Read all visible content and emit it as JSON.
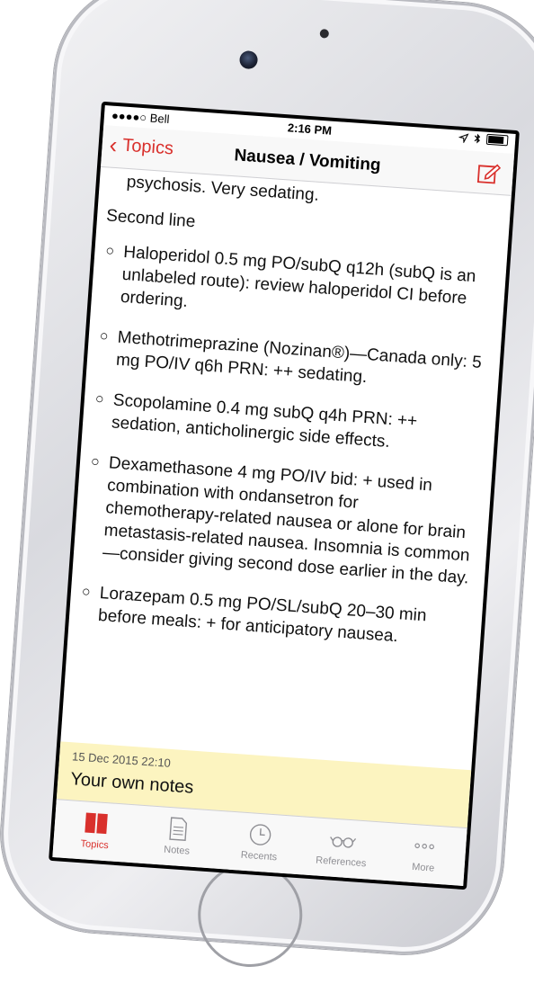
{
  "status_bar": {
    "carrier": "●●●●○ Bell",
    "time": "2:16 PM"
  },
  "nav": {
    "back_label": "Topics",
    "title": "Nausea / Vomiting"
  },
  "content": {
    "top_text": "psychosis. Very sedating.",
    "section_heading": "Second line",
    "bullets": [
      "Haloperidol 0.5 mg PO/subQ q12h (subQ is an unlabeled route): review haloperidol CI before ordering.",
      "Methotrimeprazine (Nozinan®)—Canada only: 5 mg PO/IV q6h PRN: ++ sedating.",
      "Scopolamine 0.4 mg subQ q4h PRN: ++ sedation, anticholinergic side effects.",
      "Dexamethasone 4 mg PO/IV bid: + used in combination with ondansetron for chemotherapy-related nausea or alone for brain metastasis-related nausea. Insomnia is common—consider giving second dose earlier in the day.",
      "Lorazepam 0.5 mg PO/SL/subQ 20–30 min before meals: + for anticipatory nausea."
    ]
  },
  "note": {
    "date": "15 Dec 2015 22:10",
    "text": "Your own notes"
  },
  "tabs": [
    {
      "label": "Topics",
      "icon": "book-icon",
      "active": true
    },
    {
      "label": "Notes",
      "icon": "document-icon",
      "active": false
    },
    {
      "label": "Recents",
      "icon": "clock-icon",
      "active": false
    },
    {
      "label": "References",
      "icon": "glasses-icon",
      "active": false
    },
    {
      "label": "More",
      "icon": "more-icon",
      "active": false
    }
  ],
  "colors": {
    "accent": "#d9302c",
    "note_background": "#fcf4c0"
  }
}
